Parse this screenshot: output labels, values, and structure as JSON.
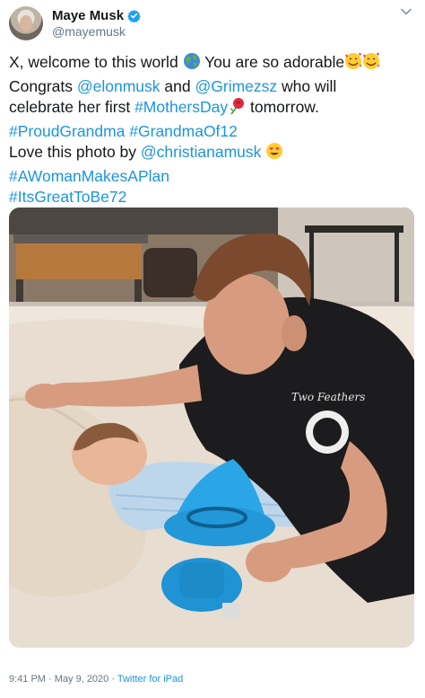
{
  "author": {
    "display_name": "Maye Musk",
    "handle": "@mayemusk",
    "verified": true,
    "avatar_icon": "profile-avatar"
  },
  "tweet": {
    "lines": [
      [
        {
          "text": "X, welcome to this world ",
          "type": "text"
        },
        {
          "icon": "globe-emoji",
          "type": "emoji"
        },
        {
          "text": " You are so adorable",
          "type": "text"
        },
        {
          "icon": "smiling-face-with-hearts-emoji",
          "type": "emoji"
        },
        {
          "icon": "smiling-face-with-hearts-emoji",
          "type": "emoji"
        }
      ],
      [
        {
          "text": "Congrats ",
          "type": "text"
        },
        {
          "text": "@elonmusk",
          "type": "link"
        },
        {
          "text": " and ",
          "type": "text"
        },
        {
          "text": "@Grimezsz",
          "type": "link"
        },
        {
          "text": " who will",
          "type": "text"
        }
      ],
      [
        {
          "text": "celebrate her first ",
          "type": "text"
        },
        {
          "text": "#MothersDay",
          "type": "link"
        },
        {
          "icon": "rose-emoji",
          "type": "emoji"
        },
        {
          "text": " tomorrow.",
          "type": "text"
        }
      ],
      [
        {
          "text": "#ProudGrandma",
          "type": "link"
        },
        {
          "text": " ",
          "type": "text"
        },
        {
          "text": "#GrandmaOf12",
          "type": "link"
        }
      ],
      [
        {
          "text": "Love this photo by ",
          "type": "text"
        },
        {
          "text": "@christianamusk",
          "type": "link"
        },
        {
          "text": " ",
          "type": "text"
        },
        {
          "icon": "heart-eyes-emoji",
          "type": "emoji"
        }
      ],
      [
        {
          "text": "#AWomanMakesAPlan",
          "type": "link"
        }
      ],
      [
        {
          "text": "#ItsGreatToBe72",
          "type": "link"
        }
      ]
    ]
  },
  "photo": {
    "tshirt_text": "Two Feathers"
  },
  "footer": {
    "time": "9:41 PM",
    "separator_1": " · ",
    "date": "May 9, 2020",
    "separator_2": " · ",
    "source": "Twitter for iPad"
  },
  "colors": {
    "link": "#1b95e0",
    "text": "#14171a",
    "secondary": "#657786",
    "verified": "#1da1f2"
  }
}
